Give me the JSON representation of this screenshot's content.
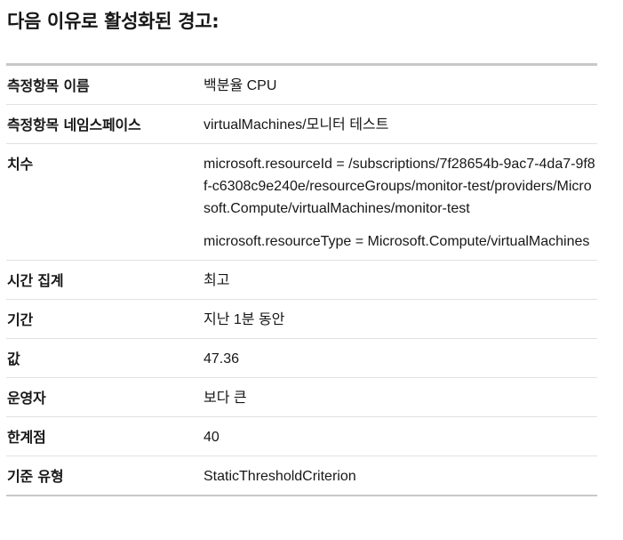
{
  "heading": "다음 이유로 활성화된 경고:",
  "rows": [
    {
      "label": "측정항목 이름",
      "values": [
        "백분율 CPU"
      ]
    },
    {
      "label": "측정항목 네임스페이스",
      "values": [
        "virtualMachines/모니터 테스트"
      ]
    },
    {
      "label": "치수",
      "values": [
        "microsoft.resourceId = /subscriptions/7f28654b-9ac7-4da7-9f8f-c6308c9e240e/resourceGroups/monitor-test/providers/Microsoft.Compute/virtualMachines/monitor-test",
        "microsoft.resourceType = Microsoft.Compute/virtualMachines"
      ]
    },
    {
      "label": "시간 집계",
      "values": [
        "최고"
      ]
    },
    {
      "label": "기간",
      "values": [
        "지난 1분 동안"
      ]
    },
    {
      "label": "값",
      "values": [
        "47.36"
      ]
    },
    {
      "label": "운영자",
      "values": [
        "보다 큰"
      ]
    },
    {
      "label": "한계점",
      "values": [
        "40"
      ]
    },
    {
      "label": "기준 유형",
      "values": [
        "StaticThresholdCriterion"
      ]
    }
  ]
}
